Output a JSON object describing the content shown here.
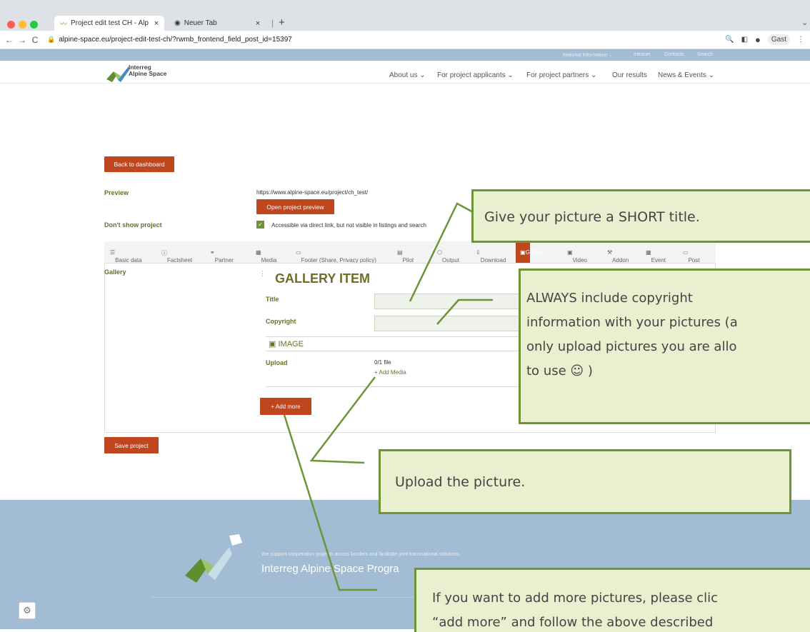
{
  "browser": {
    "tab1_title": "Project edit test CH - Alpine Sp",
    "tab2_title": "Neuer Tab",
    "url": "alpine-space.eu/project-edit-test-ch/?rwmb_frontend_field_post_id=15397",
    "profile": "Gast"
  },
  "topbar": {
    "national": "National information ⌄",
    "intranet": "Intranet",
    "contacts": "Contacts",
    "search": "Search"
  },
  "logo": {
    "line1": "Interreg",
    "line2": "Alpine Space"
  },
  "nav": [
    "About us ⌄",
    "For project applicants ⌄",
    "For project partners ⌄",
    "Our results",
    "News & Events ⌄"
  ],
  "buttons": {
    "back": "Back to dashboard",
    "preview": "Open project preview",
    "add_more": "+ Add more",
    "save": "Save project",
    "add_media": "+ Add Media"
  },
  "form": {
    "preview_label": "Preview",
    "preview_url": "https://www.alpine-space.eu/project/ch_test/",
    "dont_show_label": "Don't show project",
    "checkbox_text": "Accessible via direct link, but not visible in listings and search",
    "gallery_label": "Gallery",
    "gallery_item": "GALLERY ITEM",
    "title_label": "Title",
    "copyright_label": "Copyright",
    "image_label": "IMAGE",
    "upload_label": "Upload",
    "file_count": "0/1 file"
  },
  "tabs": [
    "Basic data",
    "Factsheet",
    "Partner",
    "Media",
    "Footer (Share, Privacy policy)",
    "Pilot",
    "Output",
    "Download",
    "Gallery",
    "Video",
    "Addon",
    "Event",
    "Post"
  ],
  "callouts": {
    "title": "Give your picture a SHORT title.",
    "copyright_l1": "ALWAYS include copyright",
    "copyright_l2": "information with your pictures (a",
    "copyright_l3": "only upload pictures you are allo",
    "copyright_l4": "to use ☺ )",
    "upload": "Upload the picture.",
    "more_l1": "If you want to add more pictures, please clic",
    "more_l2": "“add more” and follow the above described"
  },
  "footer": {
    "tagline": "We support cooperation projects across borders and facilitate joint transnational solutions.",
    "programme": "Interreg Alpine Space Progra"
  },
  "colors": {
    "accent": "#c0461f",
    "callout_border": "#6d9537",
    "callout_bg": "#e9f0cf",
    "footer": "#a1bcd3"
  }
}
